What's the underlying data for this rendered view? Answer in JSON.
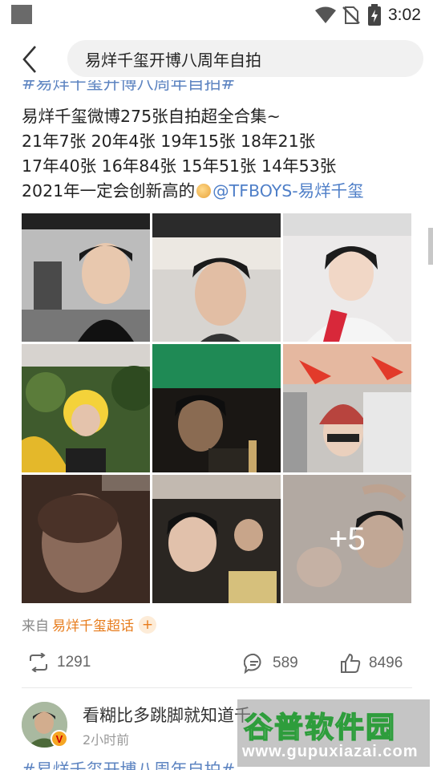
{
  "status_bar": {
    "time": "3:02",
    "icons": [
      "notification-square-icon",
      "wifi-icon",
      "no-sim-icon",
      "battery-charging-icon"
    ]
  },
  "header": {
    "back_icon": "chevron-left-icon",
    "search_text": "易烊千玺开博八周年自拍"
  },
  "post": {
    "topic_tag": "#易烊千玺开博八周年自拍#",
    "lines": [
      "易烊千玺微博275张自拍超全合集~",
      "21年7张 20年4张 19年15张 18年21张",
      "17年40张 16年84张 15年51张 14年53张"
    ],
    "last_line_text": "2021年一定会创新高的",
    "mention": "@TFBOYS-易烊千玺",
    "more_count_label": "+5",
    "source_prefix": "来自",
    "source_name": "易烊千玺超话",
    "source_plus": "+",
    "reposts": "1291",
    "comments": "589",
    "likes": "8496"
  },
  "next_post": {
    "nickname": "看糊比多跳脚就知道千",
    "time": "2小时前",
    "topic_tag": "#易烊千玺开博八周年自拍#",
    "verified_badge": "V"
  },
  "watermark": {
    "cn": "谷普软件园",
    "en": "www.gupuxiazai.com"
  },
  "colors": {
    "link": "#5d84c1",
    "accent_orange": "#e77c1c",
    "watermark_green": "#2e9d3c"
  }
}
